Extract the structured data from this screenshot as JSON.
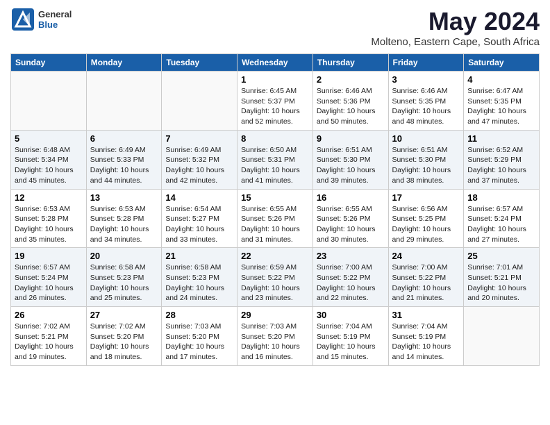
{
  "header": {
    "logo": {
      "general": "General",
      "blue": "Blue"
    },
    "title": "May 2024",
    "location": "Molteno, Eastern Cape, South Africa"
  },
  "days_of_week": [
    "Sunday",
    "Monday",
    "Tuesday",
    "Wednesday",
    "Thursday",
    "Friday",
    "Saturday"
  ],
  "weeks": [
    [
      {
        "day": "",
        "info": ""
      },
      {
        "day": "",
        "info": ""
      },
      {
        "day": "",
        "info": ""
      },
      {
        "day": "1",
        "info": "Sunrise: 6:45 AM\nSunset: 5:37 PM\nDaylight: 10 hours and 52 minutes."
      },
      {
        "day": "2",
        "info": "Sunrise: 6:46 AM\nSunset: 5:36 PM\nDaylight: 10 hours and 50 minutes."
      },
      {
        "day": "3",
        "info": "Sunrise: 6:46 AM\nSunset: 5:35 PM\nDaylight: 10 hours and 48 minutes."
      },
      {
        "day": "4",
        "info": "Sunrise: 6:47 AM\nSunset: 5:35 PM\nDaylight: 10 hours and 47 minutes."
      }
    ],
    [
      {
        "day": "5",
        "info": "Sunrise: 6:48 AM\nSunset: 5:34 PM\nDaylight: 10 hours and 45 minutes."
      },
      {
        "day": "6",
        "info": "Sunrise: 6:49 AM\nSunset: 5:33 PM\nDaylight: 10 hours and 44 minutes."
      },
      {
        "day": "7",
        "info": "Sunrise: 6:49 AM\nSunset: 5:32 PM\nDaylight: 10 hours and 42 minutes."
      },
      {
        "day": "8",
        "info": "Sunrise: 6:50 AM\nSunset: 5:31 PM\nDaylight: 10 hours and 41 minutes."
      },
      {
        "day": "9",
        "info": "Sunrise: 6:51 AM\nSunset: 5:30 PM\nDaylight: 10 hours and 39 minutes."
      },
      {
        "day": "10",
        "info": "Sunrise: 6:51 AM\nSunset: 5:30 PM\nDaylight: 10 hours and 38 minutes."
      },
      {
        "day": "11",
        "info": "Sunrise: 6:52 AM\nSunset: 5:29 PM\nDaylight: 10 hours and 37 minutes."
      }
    ],
    [
      {
        "day": "12",
        "info": "Sunrise: 6:53 AM\nSunset: 5:28 PM\nDaylight: 10 hours and 35 minutes."
      },
      {
        "day": "13",
        "info": "Sunrise: 6:53 AM\nSunset: 5:28 PM\nDaylight: 10 hours and 34 minutes."
      },
      {
        "day": "14",
        "info": "Sunrise: 6:54 AM\nSunset: 5:27 PM\nDaylight: 10 hours and 33 minutes."
      },
      {
        "day": "15",
        "info": "Sunrise: 6:55 AM\nSunset: 5:26 PM\nDaylight: 10 hours and 31 minutes."
      },
      {
        "day": "16",
        "info": "Sunrise: 6:55 AM\nSunset: 5:26 PM\nDaylight: 10 hours and 30 minutes."
      },
      {
        "day": "17",
        "info": "Sunrise: 6:56 AM\nSunset: 5:25 PM\nDaylight: 10 hours and 29 minutes."
      },
      {
        "day": "18",
        "info": "Sunrise: 6:57 AM\nSunset: 5:24 PM\nDaylight: 10 hours and 27 minutes."
      }
    ],
    [
      {
        "day": "19",
        "info": "Sunrise: 6:57 AM\nSunset: 5:24 PM\nDaylight: 10 hours and 26 minutes."
      },
      {
        "day": "20",
        "info": "Sunrise: 6:58 AM\nSunset: 5:23 PM\nDaylight: 10 hours and 25 minutes."
      },
      {
        "day": "21",
        "info": "Sunrise: 6:58 AM\nSunset: 5:23 PM\nDaylight: 10 hours and 24 minutes."
      },
      {
        "day": "22",
        "info": "Sunrise: 6:59 AM\nSunset: 5:22 PM\nDaylight: 10 hours and 23 minutes."
      },
      {
        "day": "23",
        "info": "Sunrise: 7:00 AM\nSunset: 5:22 PM\nDaylight: 10 hours and 22 minutes."
      },
      {
        "day": "24",
        "info": "Sunrise: 7:00 AM\nSunset: 5:22 PM\nDaylight: 10 hours and 21 minutes."
      },
      {
        "day": "25",
        "info": "Sunrise: 7:01 AM\nSunset: 5:21 PM\nDaylight: 10 hours and 20 minutes."
      }
    ],
    [
      {
        "day": "26",
        "info": "Sunrise: 7:02 AM\nSunset: 5:21 PM\nDaylight: 10 hours and 19 minutes."
      },
      {
        "day": "27",
        "info": "Sunrise: 7:02 AM\nSunset: 5:20 PM\nDaylight: 10 hours and 18 minutes."
      },
      {
        "day": "28",
        "info": "Sunrise: 7:03 AM\nSunset: 5:20 PM\nDaylight: 10 hours and 17 minutes."
      },
      {
        "day": "29",
        "info": "Sunrise: 7:03 AM\nSunset: 5:20 PM\nDaylight: 10 hours and 16 minutes."
      },
      {
        "day": "30",
        "info": "Sunrise: 7:04 AM\nSunset: 5:19 PM\nDaylight: 10 hours and 15 minutes."
      },
      {
        "day": "31",
        "info": "Sunrise: 7:04 AM\nSunset: 5:19 PM\nDaylight: 10 hours and 14 minutes."
      },
      {
        "day": "",
        "info": ""
      }
    ]
  ]
}
